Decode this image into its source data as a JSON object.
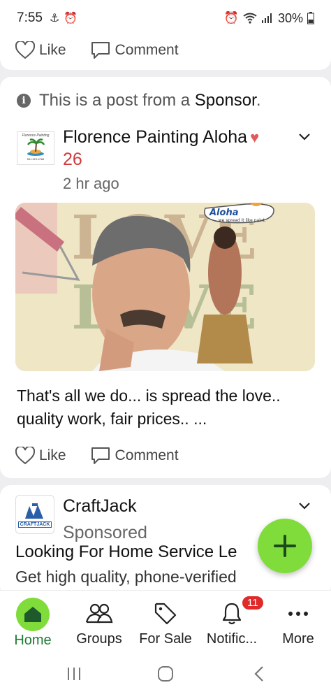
{
  "status_bar": {
    "time": "7:55",
    "battery": "30%"
  },
  "top_card": {
    "like_label": "Like",
    "comment_label": "Comment"
  },
  "sponsored_post": {
    "notice_prefix": "This is a post from a",
    "notice_sponsor": "Sponsor",
    "notice_suffix": ".",
    "author": "Florence Painting Aloha",
    "author_badge_count": "26",
    "time": "2 hr ago",
    "avatar_logo_text": "Florence Painting",
    "avatar_phone": "541.321.6766",
    "image_speech_bubble_title": "Aloha",
    "image_speech_bubble_sub": "...we spread it like paint.",
    "text": "That's all we do... is spread the love.. quality work, fair prices.. ...",
    "like_label": "Like",
    "comment_label": "Comment"
  },
  "craftjack_post": {
    "author": "CraftJack",
    "subtitle": "Sponsored",
    "avatar_text": "CRAFTJACK",
    "headline": "Looking For Home Service Le",
    "description": "Get high quality, phone-verified"
  },
  "bottom_nav": {
    "items": [
      {
        "label": "Home",
        "icon": "house-icon"
      },
      {
        "label": "Groups",
        "icon": "people-icon"
      },
      {
        "label": "For Sale",
        "icon": "tag-icon"
      },
      {
        "label": "Notific...",
        "icon": "bell-icon",
        "badge": "11"
      },
      {
        "label": "More",
        "icon": "more-dots-icon"
      }
    ]
  },
  "colors": {
    "accent_green": "#7fdc3a",
    "home_label_green": "#1e7a34",
    "badge_red": "#e02a2a",
    "count_red": "#d03a3a"
  }
}
